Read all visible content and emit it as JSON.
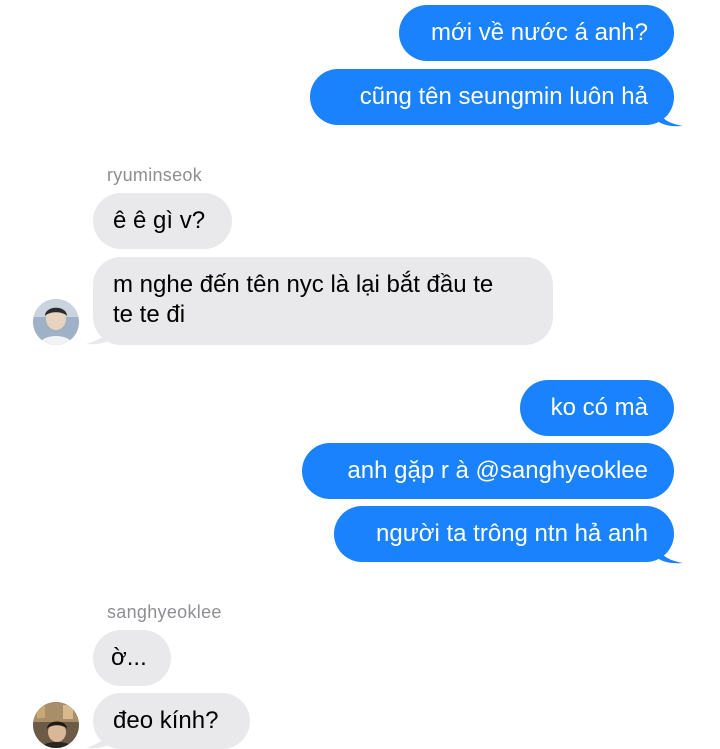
{
  "colors": {
    "outgoing_bubble": "#1982fc",
    "incoming_bubble": "#e9e9eb",
    "sender_label": "#8e8e93"
  },
  "conversation": {
    "group1_outgoing": [
      {
        "text": "mới về nước á anh?"
      },
      {
        "text": "cũng tên seungmin luôn hả"
      }
    ],
    "group2": {
      "sender": "ryuminseok",
      "avatar_icon": "profile-photo-icon",
      "messages": [
        {
          "text": "ê ê gì v?"
        },
        {
          "line1": "m nghe đến tên nyc là lại bắt đầu te",
          "line2": "te te đi"
        }
      ]
    },
    "group3_outgoing": [
      {
        "text": "ko có mà"
      },
      {
        "text": "anh gặp r à @sanghyeoklee"
      },
      {
        "text": "người ta trông ntn hả anh"
      }
    ],
    "group4": {
      "sender": "sanghyeoklee",
      "avatar_icon": "profile-photo-icon",
      "messages": [
        {
          "text": "ờ..."
        },
        {
          "text": "đeo kính?"
        }
      ]
    }
  }
}
